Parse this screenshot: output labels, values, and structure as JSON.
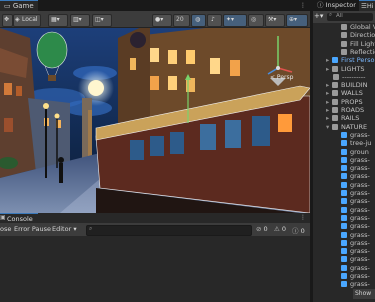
{
  "game_panel": {
    "tab_label": "Game"
  },
  "scene_toolbar": {
    "pivot_label": "Local",
    "gizmo_scale": "20",
    "persp_label": "< Persp"
  },
  "inspector": {
    "tab_label": "Inspector",
    "hierarchy_tab_label": "Hi",
    "search_placeholder": "All"
  },
  "hierarchy": {
    "items": [
      {
        "label": "Global Vo",
        "icon": "grey-cube-icon",
        "indent": 2
      },
      {
        "label": "Direction",
        "icon": "grey-cube-icon",
        "indent": 2
      },
      {
        "label": "Fill Light",
        "icon": "grey-cube-icon",
        "indent": 2
      },
      {
        "label": "Reflection",
        "icon": "grey-cube-icon",
        "indent": 2
      },
      {
        "label": "First Perso",
        "icon": "blue-cube-icon",
        "indent": 1,
        "expandable": true,
        "highlight": true
      },
      {
        "label": "LIGHTS",
        "icon": "grey-cube-icon",
        "indent": 1,
        "expandable": true
      },
      {
        "label": "----------",
        "icon": "grey-cube-icon",
        "indent": 1
      },
      {
        "label": "BUILDIN",
        "icon": "grey-cube-icon",
        "indent": 1,
        "expandable": true
      },
      {
        "label": "WALLS",
        "icon": "grey-cube-icon",
        "indent": 1,
        "expandable": true
      },
      {
        "label": "PROPS",
        "icon": "grey-cube-icon",
        "indent": 1,
        "expandable": true
      },
      {
        "label": "ROADS",
        "icon": "grey-cube-icon",
        "indent": 1,
        "expandable": true
      },
      {
        "label": "RAILS",
        "icon": "grey-cube-icon",
        "indent": 1,
        "expandable": true
      },
      {
        "label": "NATURE",
        "icon": "grey-cube-icon",
        "indent": 1,
        "expandable": true,
        "expanded": true
      },
      {
        "label": "grass-",
        "icon": "blue-cube-icon",
        "indent": 2
      },
      {
        "label": "tree-ju",
        "icon": "blue-cube-icon",
        "indent": 2
      },
      {
        "label": "groun",
        "icon": "blue-cube-icon",
        "indent": 2
      },
      {
        "label": "grass-",
        "icon": "blue-cube-icon",
        "indent": 2
      },
      {
        "label": "grass-",
        "icon": "blue-cube-icon",
        "indent": 2
      },
      {
        "label": "grass-",
        "icon": "blue-cube-icon",
        "indent": 2
      },
      {
        "label": "grass-",
        "icon": "blue-cube-icon",
        "indent": 2
      },
      {
        "label": "grass-",
        "icon": "blue-cube-icon",
        "indent": 2
      },
      {
        "label": "grass-",
        "icon": "blue-cube-icon",
        "indent": 2
      },
      {
        "label": "grass-",
        "icon": "blue-cube-icon",
        "indent": 2
      },
      {
        "label": "grass-",
        "icon": "blue-cube-icon",
        "indent": 2
      },
      {
        "label": "grass-",
        "icon": "blue-cube-icon",
        "indent": 2
      },
      {
        "label": "grass-",
        "icon": "blue-cube-icon",
        "indent": 2
      },
      {
        "label": "grass-",
        "icon": "blue-cube-icon",
        "indent": 2
      },
      {
        "label": "grass-",
        "icon": "blue-cube-icon",
        "indent": 2
      },
      {
        "label": "grass-",
        "icon": "blue-cube-icon",
        "indent": 2
      },
      {
        "label": "grass-",
        "icon": "blue-cube-icon",
        "indent": 2
      },
      {
        "label": "grass-",
        "icon": "blue-cube-icon",
        "indent": 2
      },
      {
        "label": "grass-",
        "icon": "blue-cube-icon",
        "indent": 2
      }
    ]
  },
  "console": {
    "tab_label": "Console",
    "clear_label": "ose",
    "error_pause_label": "Error Pause",
    "editor_label": "Editor",
    "error_count": "0",
    "warning_count": "0",
    "log_count": "0"
  },
  "bottom": {
    "show_label": "Show"
  },
  "colors": {
    "selection_blue": "#3a79bb",
    "accent_icon_blue": "#4aa7ff",
    "panel_bg": "#282828"
  }
}
